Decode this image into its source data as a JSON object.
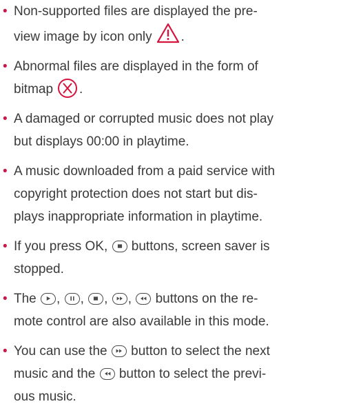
{
  "bullet_char": "•",
  "items": [
    {
      "parts": [
        "Non-supported files are displayed the pre-",
        "view image by icon only",
        "."
      ],
      "icon": "warning-triangle-icon"
    },
    {
      "parts": [
        "Abnormal files are displayed in the form of",
        "bitmap",
        "."
      ],
      "icon": "x-circle-icon"
    },
    {
      "parts": [
        "A damaged or corrupted music does not play",
        "but displays 00:00 in playtime."
      ]
    },
    {
      "parts": [
        "A music downloaded from a paid service with",
        "copyright protection does not start but dis-",
        "plays inappropriate information in playtime."
      ]
    },
    {
      "parts": [
        "If you press OK,",
        "buttons, screen saver is",
        "stopped."
      ],
      "icon": "stop-button-icon"
    },
    {
      "parts": [
        "The",
        ",",
        ",",
        ",",
        ",",
        "buttons on the re-",
        "mote control are also available in this mode."
      ],
      "icons": [
        "play-button-icon",
        "pause-button-icon",
        "stop-button-icon",
        "fast-forward-button-icon",
        "rewind-button-icon"
      ]
    },
    {
      "parts": [
        "You can use the",
        "button to select the next",
        "music and the",
        "button to select the previ-",
        "ous music."
      ],
      "icons": [
        "fast-forward-button-icon",
        "rewind-button-icon"
      ]
    }
  ],
  "colors": {
    "bullet": "#c9184a",
    "warning": "#d4143c",
    "text": "#3a3a3a"
  }
}
